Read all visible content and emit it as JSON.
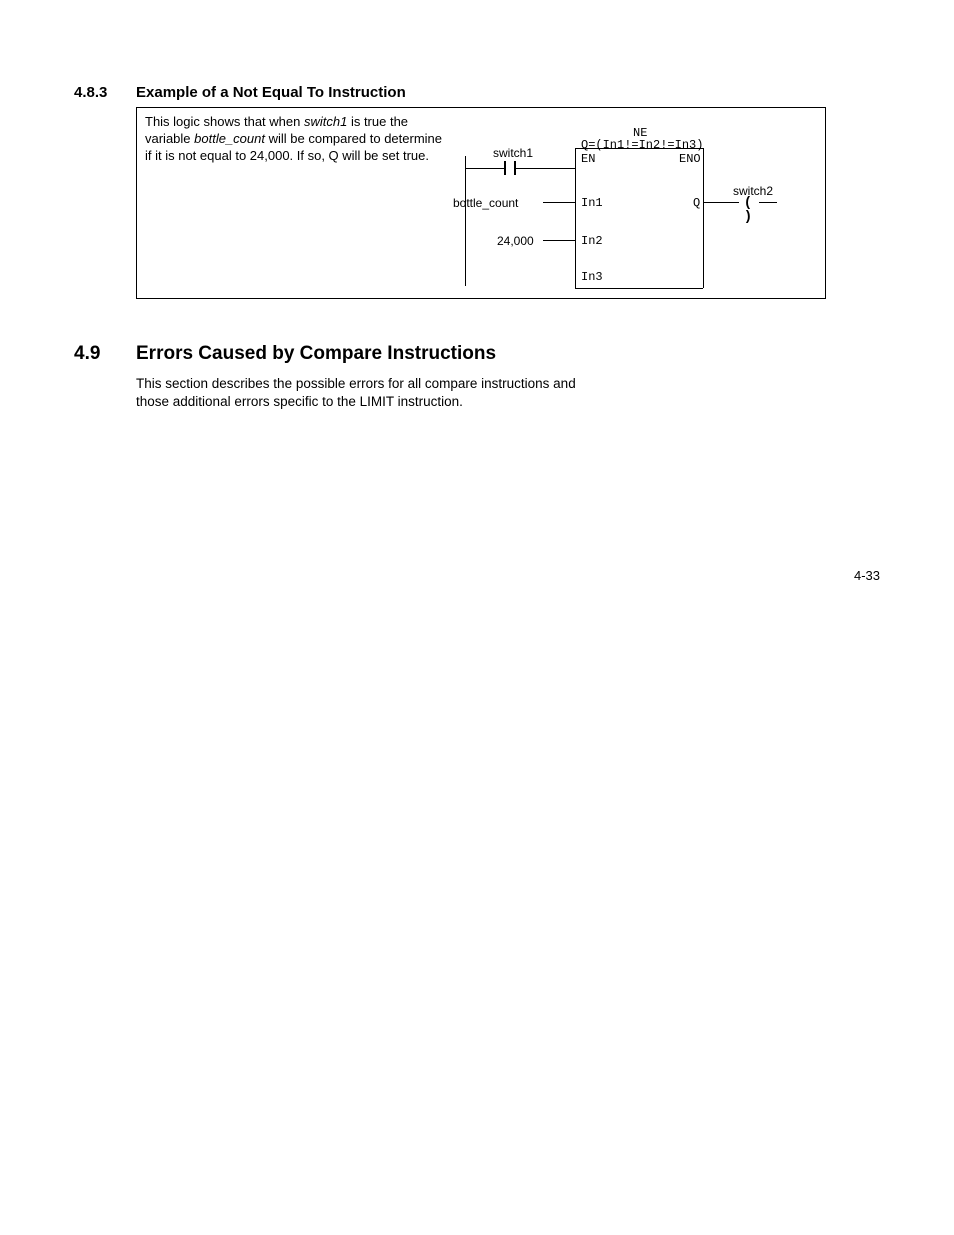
{
  "section483": {
    "number": "4.8.3",
    "title": "Example of a Not Equal To Instruction",
    "description_parts": {
      "p1": "This logic shows that when ",
      "italic1": "switch1",
      "p2": " is true the variable ",
      "italic2": "bottle_count",
      "p3": " will be compared to determine if it is not equal to 24,000. If so, Q will be set true."
    }
  },
  "diagram": {
    "switch1": "switch1",
    "bottle_count": "bottle_count",
    "value": "24,000",
    "switch2": "switch2",
    "block": {
      "name": "NE",
      "expr": "Q=(In1!=In2!=In3)",
      "EN": "EN",
      "ENO": "ENO",
      "In1": "In1",
      "In2": "In2",
      "In3": "In3",
      "Q": "Q"
    }
  },
  "section49": {
    "number": "4.9",
    "title": "Errors Caused by Compare Instructions",
    "body": "This section describes the possible errors for all compare instructions and those additional errors specific to the LIMIT instruction."
  },
  "page_number": "4-33"
}
